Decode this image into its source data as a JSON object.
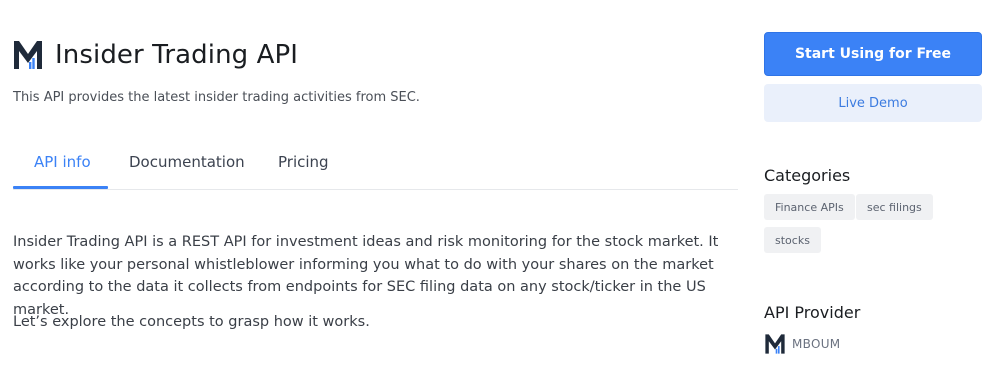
{
  "header": {
    "title": "Insider Trading API",
    "subtitle": "This API provides the latest insider trading activities from SEC.",
    "logo_icon": "mboum-logo-icon"
  },
  "tabs": [
    {
      "label": "API info",
      "active": true
    },
    {
      "label": "Documentation",
      "active": false
    },
    {
      "label": "Pricing",
      "active": false
    }
  ],
  "content": {
    "description": "Insider Trading API is a REST API for investment ideas and risk monitoring for the stock market. It works like your personal whistleblower informing you what to do with your shares on the market according to the data it collects from endpoints for SEC filing data on any stock/ticker in the US market.",
    "explore": "Let’s explore the concepts to grasp how it works."
  },
  "sidebar": {
    "start_button": "Start Using for Free",
    "demo_button": "Live Demo",
    "categories_title": "Categories",
    "categories": [
      "Finance APIs",
      "sec filings",
      "stocks"
    ],
    "provider_title": "API Provider",
    "provider_name": "MBOUM"
  },
  "colors": {
    "accent": "#3b82f6",
    "logo_dark": "#1f2a3a",
    "logo_blue": "#3b82f6"
  }
}
